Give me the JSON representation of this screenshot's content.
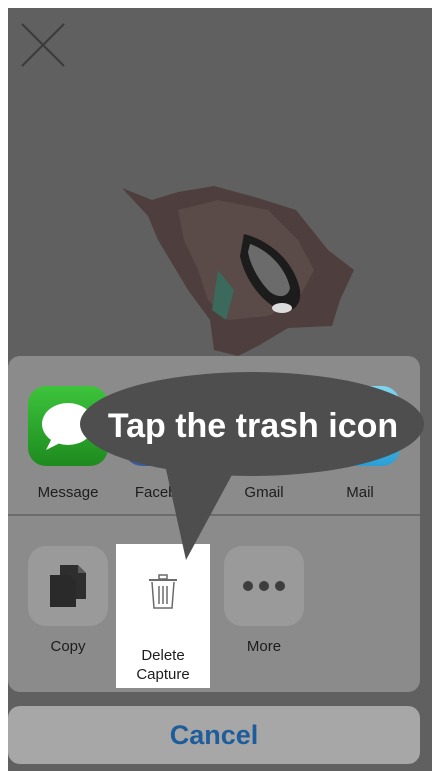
{
  "share_sheet": {
    "apps": [
      {
        "label": "Message",
        "icon": "message-icon"
      },
      {
        "label": "Faceboo",
        "icon": "facebook-icon"
      },
      {
        "label": "Gmail",
        "icon": "gmail-icon"
      },
      {
        "label": "Mail",
        "icon": "mail-icon"
      }
    ],
    "actions": [
      {
        "label": "Copy",
        "icon": "copy-icon"
      },
      {
        "label_line1": "Delete",
        "label_line2": "Capture",
        "icon": "trash-icon"
      },
      {
        "label": "More",
        "icon": "more-icon"
      }
    ],
    "cancel_label": "Cancel"
  },
  "callout": {
    "text": "Tap the trash icon"
  },
  "colors": {
    "cancel_text": "#1f5d9a",
    "callout_fill": "#4e4e4e",
    "sheet_bg": "#8b8b8b"
  }
}
